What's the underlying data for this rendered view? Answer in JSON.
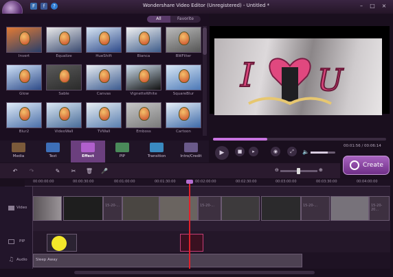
{
  "app": {
    "title": "Wondershare Video Editor (Unregistered) - Untitled *",
    "menu_icons": [
      "F",
      "f",
      "?"
    ]
  },
  "window_controls": {
    "min": "–",
    "max": "□",
    "close": "×"
  },
  "library": {
    "tabs": [
      {
        "label": "All"
      },
      {
        "label": "Favorite"
      }
    ],
    "effects": [
      "Invert",
      "Equalize",
      "HueShift",
      "Bianca",
      "BWFilter",
      "Glow",
      "Sable",
      "Canvas",
      "VignetteWhite",
      "SquareBlur",
      "Blur2",
      "VideoWall",
      "TVWall",
      "Emboss",
      "Cartoon"
    ]
  },
  "categories": [
    {
      "label": "Media"
    },
    {
      "label": "Text"
    },
    {
      "label": "Effect"
    },
    {
      "label": "PIP"
    },
    {
      "label": "Transition"
    },
    {
      "label": "Intro/Credit"
    }
  ],
  "player": {
    "time": "00:01:56 / 00:06:14",
    "progress": 0.315,
    "volume": 0.7
  },
  "create": {
    "label": "Create"
  },
  "timeline": {
    "ticks": [
      "00:00:00:00",
      "00:00:30:00",
      "00:01:00:00",
      "00:01:30:00",
      "00:02:00:00",
      "00:02:30:00",
      "00:03:00:00",
      "00:03:30:00",
      "00:04:00:00"
    ],
    "tracks": {
      "video": "Video",
      "pip": "PIP",
      "audio": "Audio"
    },
    "clip_texts": [
      "15-20-...",
      "15-20-...",
      "15-20-...",
      "15-20-20..."
    ],
    "audio_clip": "Sleep Away"
  },
  "colors": {
    "accent": "#a863c0",
    "playhead": "#e3202a"
  }
}
